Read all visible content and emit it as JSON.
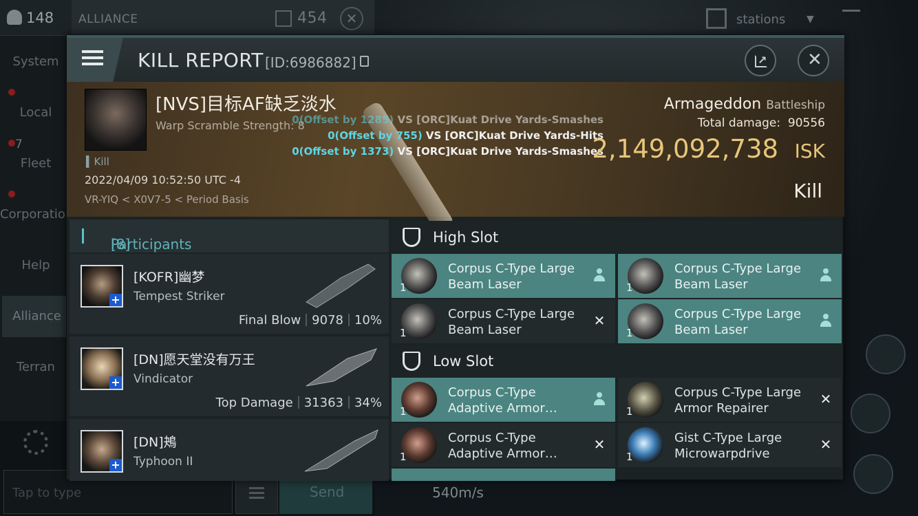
{
  "background": {
    "member_count": "148",
    "channel_title": "ALLIANCE",
    "channel_count": "454",
    "sidebar": [
      "System",
      "Local",
      "Fleet",
      "Corporation",
      "Help",
      "Alliance",
      "Terran"
    ],
    "fleet_count": "7",
    "chat_placeholder": "Tap to type",
    "send_label": "Send",
    "overview_filter": "stations",
    "speed": "540m/s"
  },
  "report": {
    "title": "KILL REPORT",
    "id": "[ID:6986882]",
    "victim": {
      "name": "[NVS]目标AF缺乏淡水",
      "warp_scramble": "Warp Scramble Strength: 8",
      "tag": "Kill",
      "datetime": "2022/04/09 10:52:50 UTC -4",
      "location": "VR-YIQ < X0V7-5 < Period Basis",
      "ship_name": "Armageddon",
      "ship_class": "Battleship",
      "total_damage_label": "Total damage:",
      "total_damage": "90556",
      "isk_value": "2,149,092,738",
      "isk_unit": "ISK",
      "result": "Kill"
    },
    "damage_feed": [
      {
        "value": "0(Offset by 1285)",
        "text": " VS [ORC]Kuat Drive Yards-Smashes"
      },
      {
        "value": "0(Offset by 755)",
        "text": " VS [ORC]Kuat Drive Yards-Hits"
      },
      {
        "value": "0(Offset by 1373)",
        "text": " VS [ORC]Kuat Drive Yards-Smashes"
      }
    ],
    "participants_label": "Participants",
    "participants_count": "[8]",
    "participants": [
      {
        "name": "[KOFR]幽梦",
        "ship": "Tempest Striker",
        "role": "Final Blow",
        "damage": "9078",
        "percent": "10%"
      },
      {
        "name": "[DN]愿天堂没有万王",
        "ship": "Vindicator",
        "role": "Top Damage",
        "damage": "31363",
        "percent": "34%"
      },
      {
        "name": "[DN]鴂",
        "ship": "Typhoon II",
        "role": "",
        "damage": "",
        "percent": ""
      }
    ],
    "high_slot_label": "High Slot",
    "low_slot_label": "Low Slot",
    "high_slots": [
      {
        "qty": "1",
        "name": "Corpus C-Type Large Beam Laser",
        "status": "dropped"
      },
      {
        "qty": "1",
        "name": "Corpus C-Type Large Beam Laser",
        "status": "dropped"
      },
      {
        "qty": "1",
        "name": "Corpus C-Type Large Beam Laser",
        "status": "destroyed"
      },
      {
        "qty": "1",
        "name": "Corpus C-Type Large Beam Laser",
        "status": "dropped"
      }
    ],
    "low_slots": [
      {
        "qty": "1",
        "name": "Corpus C-Type Adaptive Armor…",
        "status": "dropped"
      },
      {
        "qty": "1",
        "name": "Corpus C-Type Large Armor Repairer",
        "status": "destroyed"
      },
      {
        "qty": "1",
        "name": "Corpus C-Type Adaptive Armor…",
        "status": "destroyed"
      },
      {
        "qty": "1",
        "name": "Gist C-Type Large Microwarpdrive",
        "status": "destroyed"
      }
    ],
    "destroyed_mark": "✕",
    "colors": {
      "isk": "#e8c67a",
      "dropped": "#4b8481",
      "damage_value": "#5dd6e6",
      "accent": "#58c3c8"
    }
  }
}
